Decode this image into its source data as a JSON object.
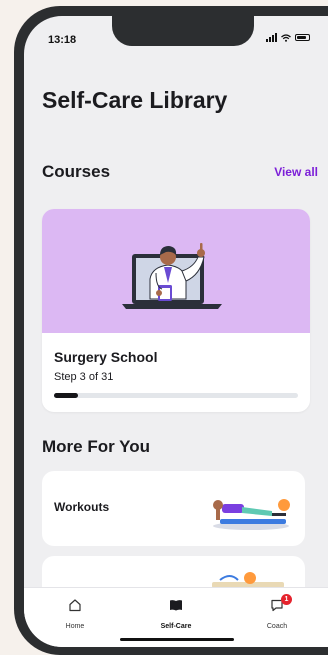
{
  "status_bar": {
    "time": "13:18",
    "icons": [
      "signal-icon",
      "wifi-icon",
      "battery-icon"
    ]
  },
  "header": {
    "title": "Self-Care Library"
  },
  "courses": {
    "heading": "Courses",
    "view_all": "View all",
    "card": {
      "name": "Surgery School",
      "step": "Step 3 of 31",
      "progress": 0.0968,
      "hero_color": "#dcb8f3",
      "illustration": "doctor-on-laptop"
    }
  },
  "more": {
    "heading": "More For You",
    "items": [
      {
        "label": "Workouts",
        "illustration": "plank-exercise"
      },
      {
        "label": "",
        "illustration": "partial-card"
      }
    ]
  },
  "tabbar": {
    "tabs": [
      {
        "label": "Home",
        "icon": "home-icon"
      },
      {
        "label": "Self-Care",
        "icon": "book-icon",
        "active": true
      },
      {
        "label": "Coach",
        "icon": "chat-icon",
        "badge": "1"
      }
    ]
  },
  "colors": {
    "accent": "#7c1fd8",
    "background": "#efeff1",
    "badge": "#e5232d"
  }
}
